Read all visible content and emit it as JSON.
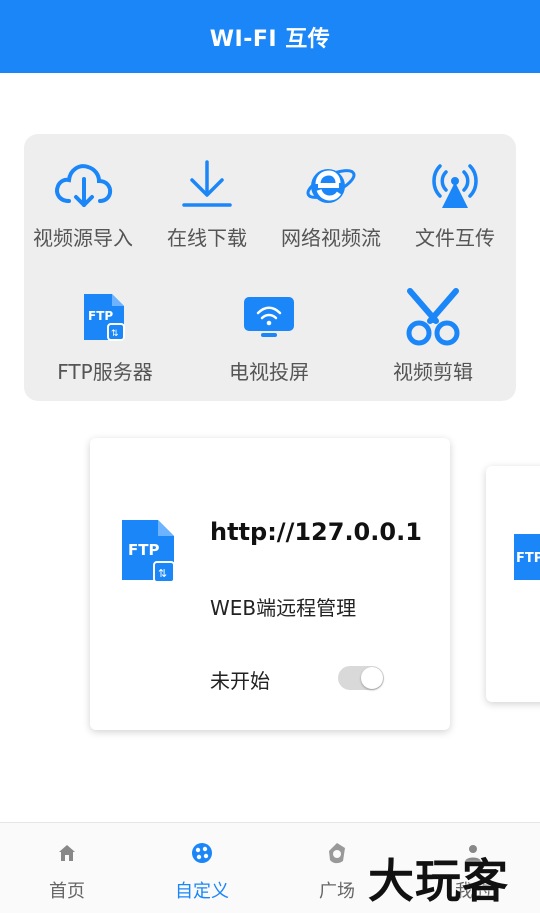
{
  "app": {
    "title": "WI-FI 互传",
    "accent": "#1a86f8"
  },
  "grid": {
    "items": [
      {
        "label": "视频源导入",
        "icon": "cloud-download-icon"
      },
      {
        "label": "在线下载",
        "icon": "download-arrow-icon"
      },
      {
        "label": "网络视频流",
        "icon": "browser-e-icon"
      },
      {
        "label": "文件互传",
        "icon": "wifi-broadcast-icon"
      },
      {
        "label": "FTP服务器",
        "icon": "ftp-file-icon"
      },
      {
        "label": "电视投屏",
        "icon": "tv-cast-icon"
      },
      {
        "label": "视频剪辑",
        "icon": "scissors-icon"
      }
    ]
  },
  "ftp_card": {
    "icon_text": "FTP",
    "url": "http://127.0.0.1",
    "description": "WEB端远程管理",
    "status": "未开始",
    "toggle_on": false
  },
  "peek_card": {
    "icon_text": "FTP"
  },
  "bottom_nav": {
    "items": [
      {
        "label": "首页",
        "icon": "home-icon"
      },
      {
        "label": "自定义",
        "icon": "custom-icon",
        "active": true
      },
      {
        "label": "广场",
        "icon": "square-icon"
      },
      {
        "label": "我的",
        "icon": "profile-icon"
      }
    ]
  },
  "watermark": "大玩客"
}
